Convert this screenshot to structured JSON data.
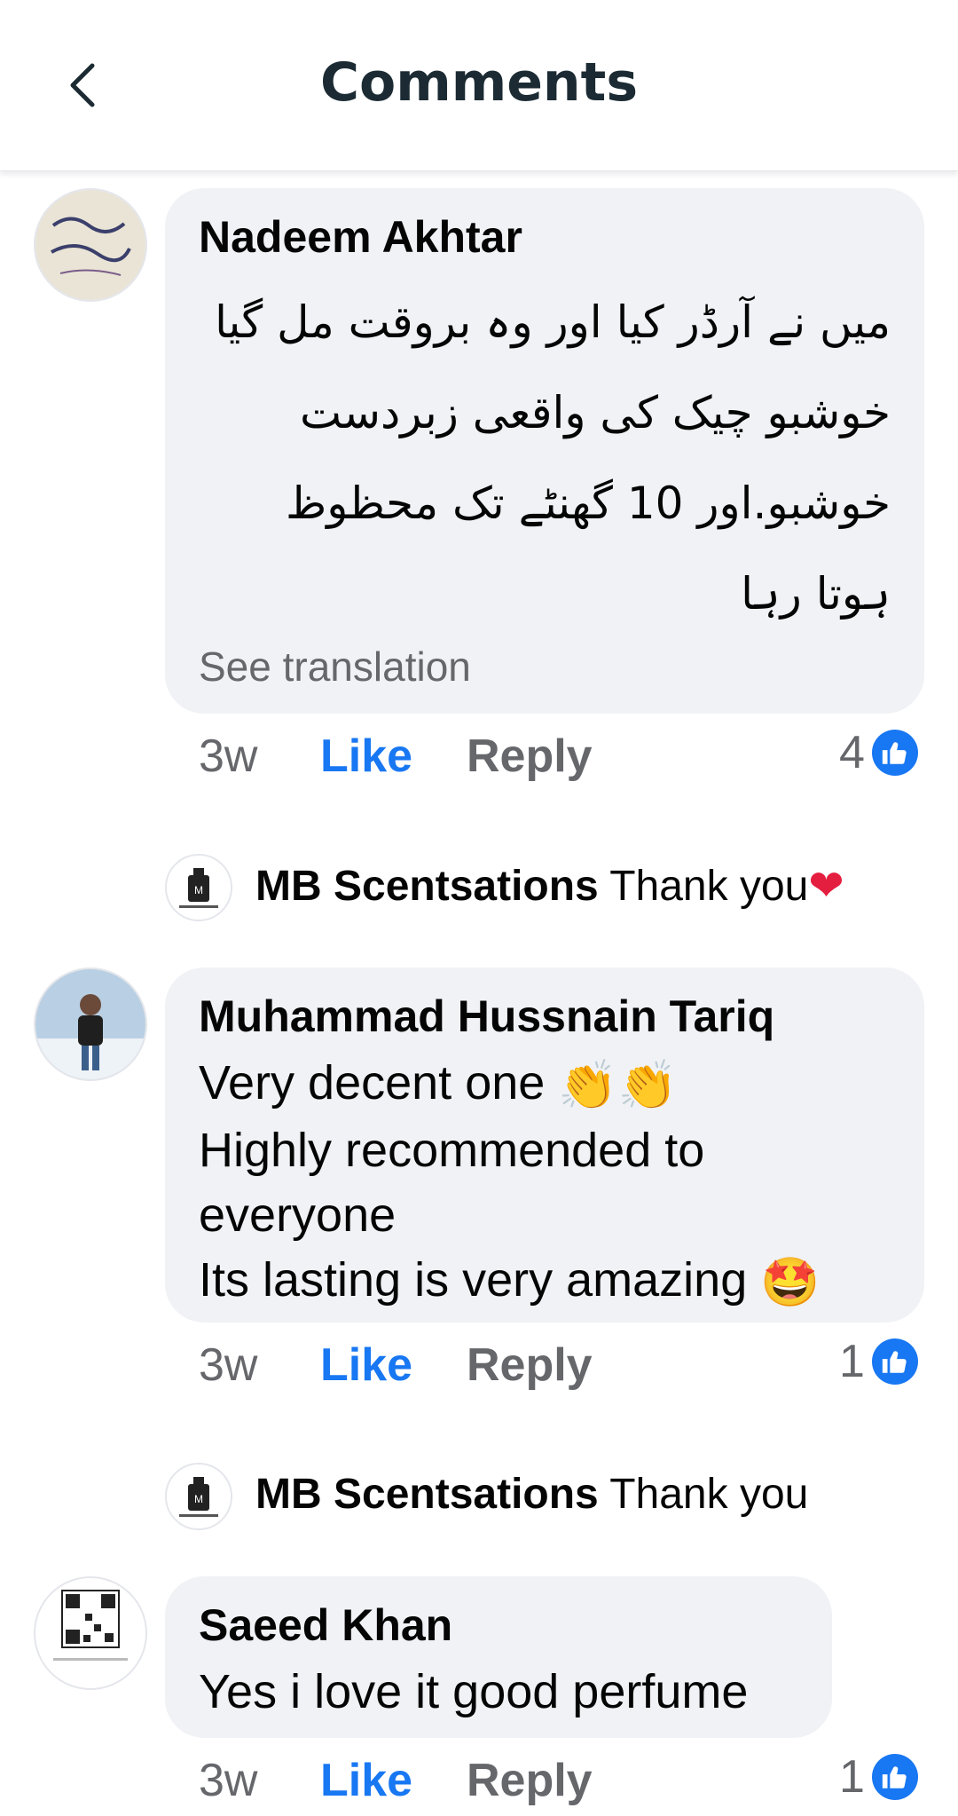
{
  "header": {
    "title": "Comments"
  },
  "comments": [
    {
      "author": "Nadeem Akhtar",
      "lines": [
        "میں نے آرڈر کیا اور وہ بروقت مل گیا",
        "خوشبو چیک کی واقعی زبردست",
        "خوشبو.اور 10 گھنٹے تک محظوظ",
        "ہوتا رہا"
      ],
      "see_translation": "See translation",
      "time": "3w",
      "like": "Like",
      "reply": "Reply",
      "reaction_count": "4",
      "reply_by": {
        "name": "MB Scentsations",
        "text": "Thank you",
        "emoji": "heart"
      }
    },
    {
      "author": "Muhammad Hussnain Tariq",
      "lines": [
        "Very decent one",
        "Highly recommended to",
        "everyone",
        "Its lasting is very amazing"
      ],
      "time": "3w",
      "like": "Like",
      "reply": "Reply",
      "reaction_count": "1",
      "reply_by": {
        "name": "MB Scentsations",
        "text": "Thank you"
      }
    },
    {
      "author": "Saeed Khan",
      "lines": [
        "Yes i love it good perfume"
      ],
      "time": "3w",
      "like": "Like",
      "reply": "Reply",
      "reaction_count": "1"
    }
  ],
  "colors": {
    "like_blue": "#1877f2",
    "bubble_bg": "#f0f2f5",
    "muted": "#65676b"
  }
}
